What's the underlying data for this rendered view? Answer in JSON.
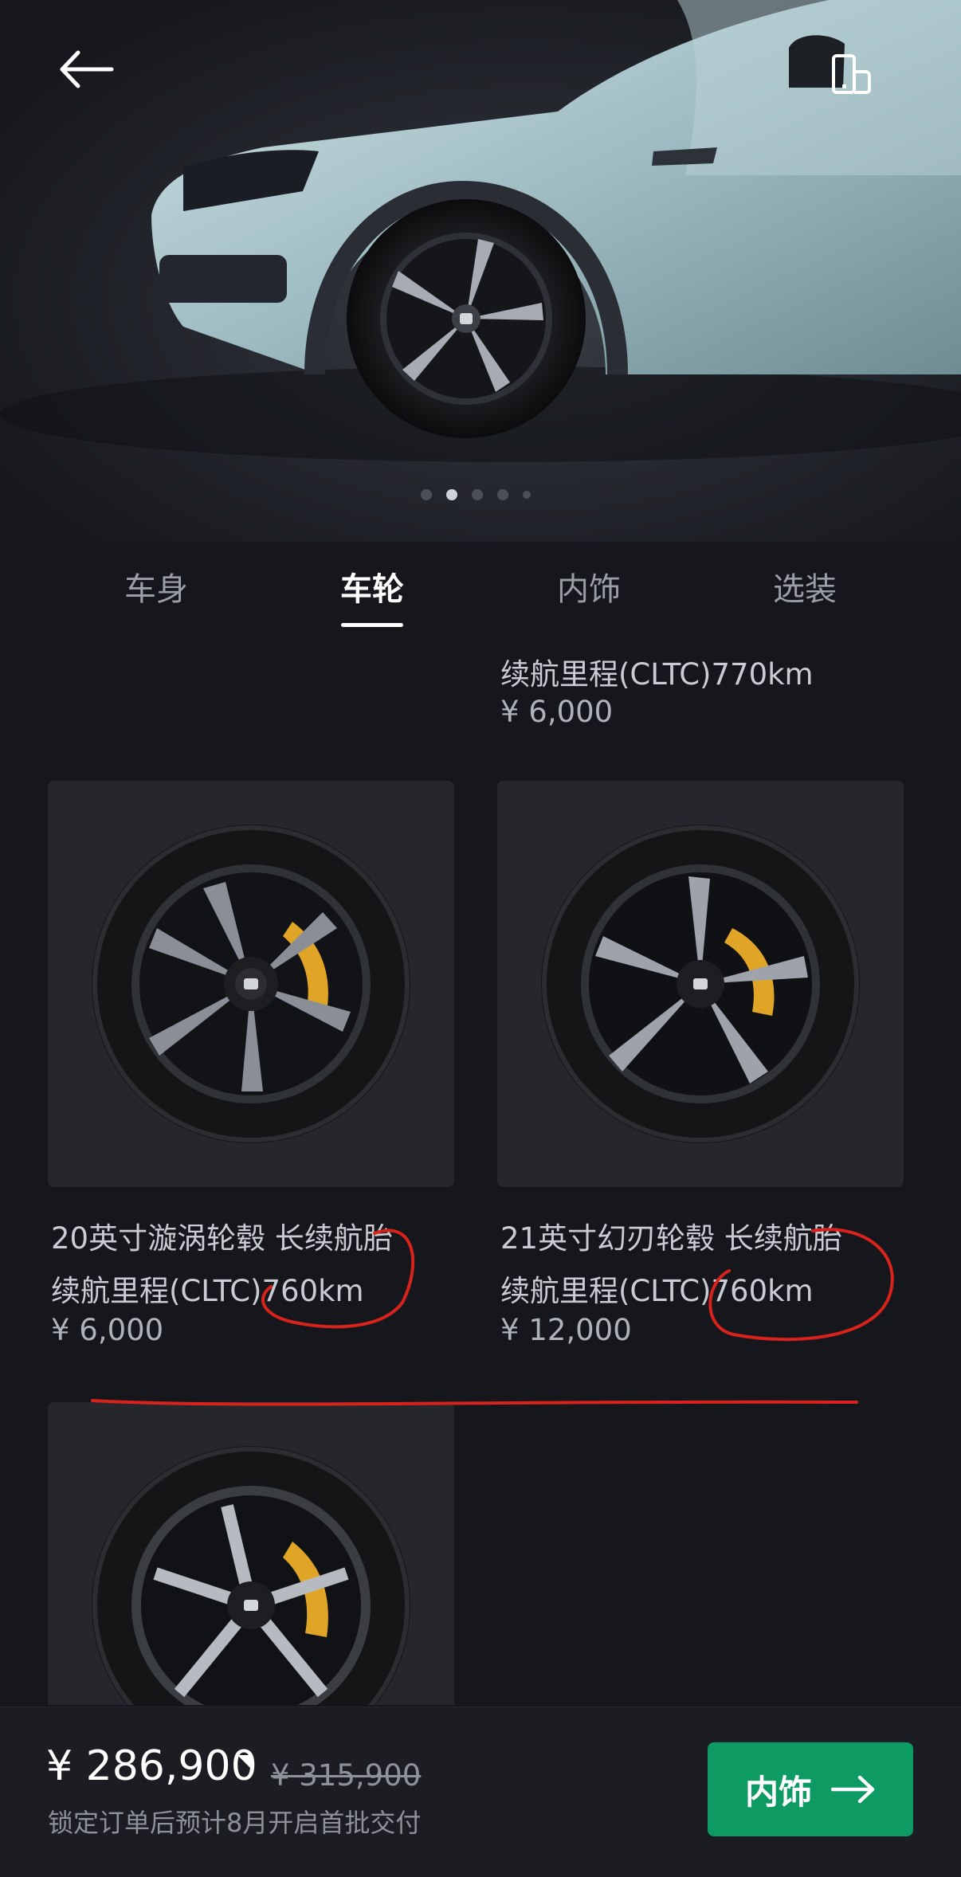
{
  "hero": {
    "back_icon": "arrow-left-icon",
    "view_icon": "phone-rotate-icon",
    "carousel": {
      "count": 5,
      "active_index": 1
    }
  },
  "tabs": [
    {
      "label": "车身",
      "active": false
    },
    {
      "label": "车轮",
      "active": true
    },
    {
      "label": "内饰",
      "active": false
    },
    {
      "label": "选装",
      "active": false
    }
  ],
  "options": {
    "prev": {
      "range": "续航里程(CLTC)770km",
      "price": "¥ 6,000"
    },
    "wheel_a": {
      "name": "20英寸漩涡轮毂 长续航胎",
      "range": "续航里程(CLTC)760km",
      "price": "¥ 6,000"
    },
    "wheel_b": {
      "name": "21英寸幻刃轮毂 长续航胎",
      "range": "续航里程(CLTC)760km",
      "price": "¥ 12,000"
    }
  },
  "colors": {
    "accent": "#0d9a63",
    "caliper": "#e0a526",
    "annotation": "#d8231c"
  },
  "bottom": {
    "price": "¥ 286,900",
    "old_price": "¥ 315,900",
    "note": "锁定订单后预计8月开启首批交付",
    "next_label": "内饰",
    "next_icon": "arrow-right-icon"
  }
}
